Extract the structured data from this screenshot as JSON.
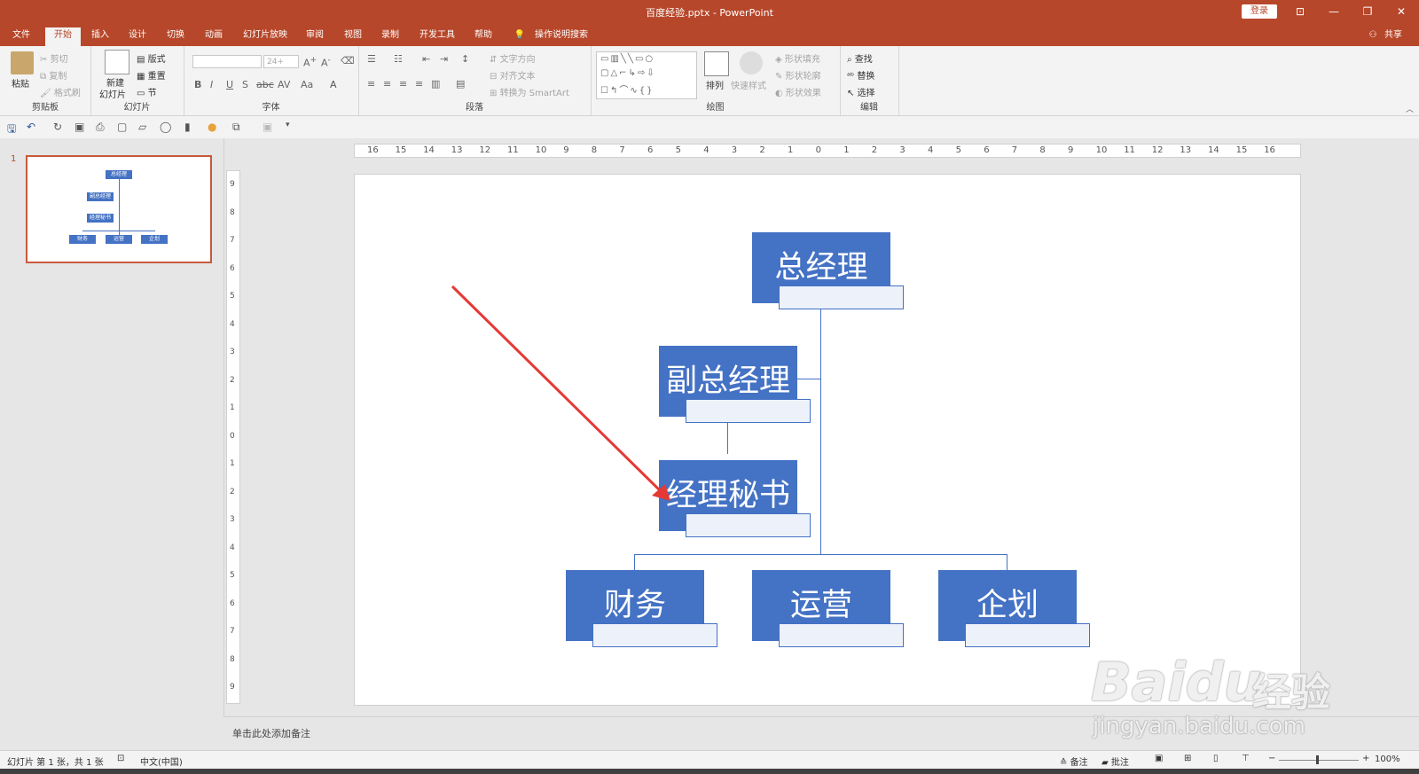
{
  "window": {
    "title": "百度经验.pptx  -  PowerPoint",
    "login_label": "登录",
    "buttons": {
      "ribbon_display": "⊡",
      "minimize": "—",
      "restore": "❐",
      "close": "✕"
    }
  },
  "menu": {
    "tabs": [
      "文件",
      "开始",
      "插入",
      "设计",
      "切换",
      "动画",
      "幻灯片放映",
      "审阅",
      "视图",
      "录制",
      "开发工具",
      "帮助"
    ],
    "active_tab": "开始",
    "tell_me": "操作说明搜索",
    "share": "共享"
  },
  "ribbon": {
    "clipboard": {
      "label": "剪贴板",
      "paste": "粘贴",
      "cut": "剪切",
      "copy": "复制",
      "format_painter": "格式刷"
    },
    "slides": {
      "label": "幻灯片",
      "new_slide": "新建",
      "new_slide_2": "幻灯片",
      "layout": "版式",
      "reset": "重置",
      "section": "节"
    },
    "font": {
      "label": "字体",
      "size": "24+",
      "bold": "B",
      "italic": "I",
      "underline": "U",
      "shadow": "S",
      "strike": "abc",
      "spacing": "AV",
      "case": "Aa",
      "color": "A"
    },
    "paragraph": {
      "label": "段落",
      "text_direction": "文字方向",
      "align_text": "对齐文本",
      "smartart": "转换为 SmartArt"
    },
    "drawing": {
      "label": "绘图",
      "arrange": "排列",
      "quick_styles": "快速样式",
      "fill": "形状填充",
      "outline": "形状轮廓",
      "effects": "形状效果"
    },
    "editing": {
      "label": "编辑",
      "find": "查找",
      "replace": "替换",
      "select": "选择"
    }
  },
  "thumbnail": {
    "number": "1",
    "labels": {
      "gm": "总经理",
      "vgm": "副总经理",
      "sec": "经理秘书",
      "fin": "财务",
      "ops": "运营",
      "plan": "企划"
    }
  },
  "ruler": {
    "h_labels": [
      "16",
      "15",
      "14",
      "13",
      "12",
      "11",
      "10",
      "9",
      "8",
      "7",
      "6",
      "5",
      "4",
      "3",
      "2",
      "1",
      "0",
      "1",
      "2",
      "3",
      "4",
      "5",
      "6",
      "7",
      "8",
      "9",
      "10",
      "11",
      "12",
      "13",
      "14",
      "15",
      "16"
    ],
    "v_labels": [
      "9",
      "8",
      "7",
      "6",
      "5",
      "4",
      "3",
      "2",
      "1",
      "0",
      "1",
      "2",
      "3",
      "4",
      "5",
      "6",
      "7",
      "8",
      "9"
    ]
  },
  "slide": {
    "boxes": {
      "gm": "总经理",
      "vgm": "副总经理",
      "sec": "经理秘书",
      "fin": "财务",
      "ops": "运营",
      "plan": "企划"
    },
    "box_color": "#4472c4",
    "arrow_color": "#e53935"
  },
  "notes": {
    "placeholder": "单击此处添加备注"
  },
  "status": {
    "slide_info": "幻灯片 第 1 张，共 1 张",
    "language": "中文(中国)",
    "notes_btn": "备注",
    "comments_btn": "批注",
    "zoom": "100%"
  },
  "watermark": {
    "brand": "Bai",
    "brand2": "du",
    "brand_cn": "经验",
    "url": "jingyan.baidu.com"
  }
}
